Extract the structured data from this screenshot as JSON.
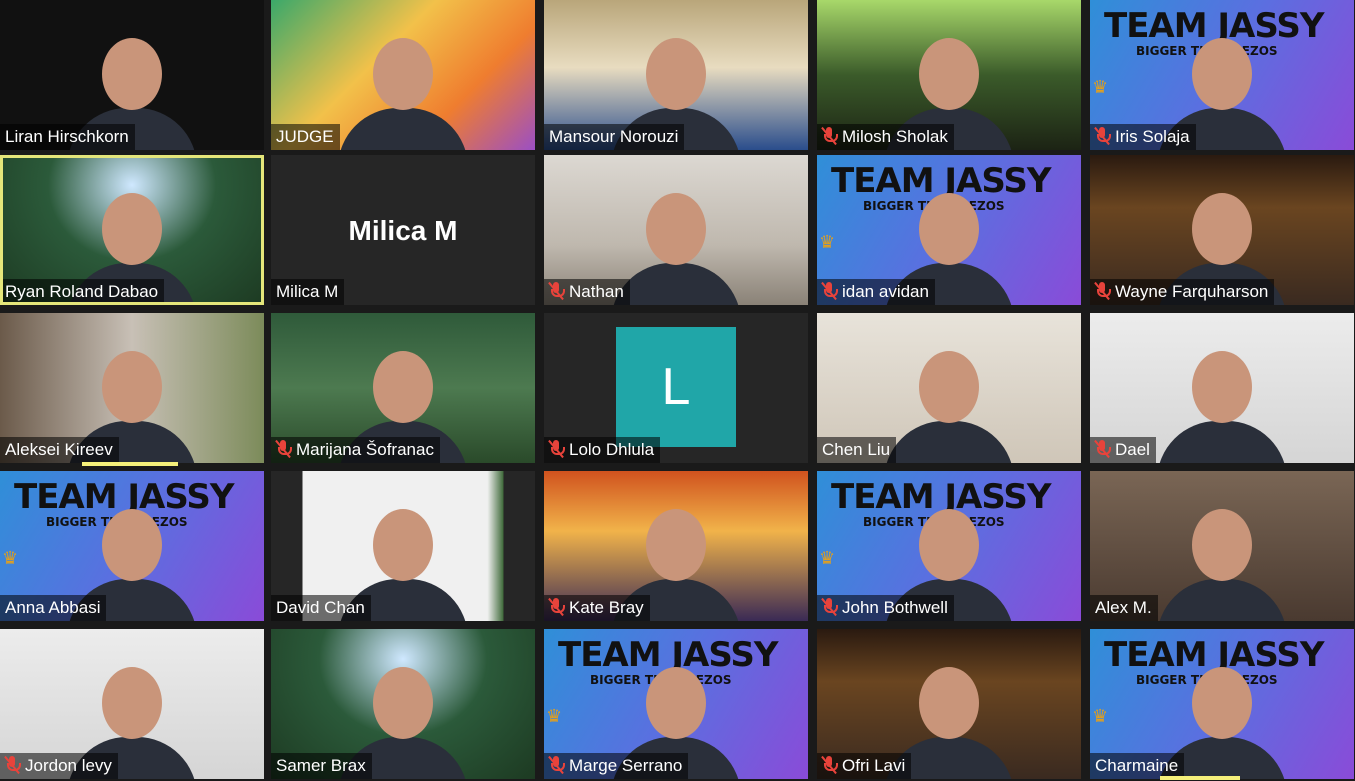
{
  "tiles": [
    {
      "name": "Liran Hirschkorn",
      "muted": false,
      "bg": "bg-dark",
      "kind": "video"
    },
    {
      "name": "JUDGE",
      "muted": false,
      "bg": "bg-olympic",
      "kind": "video"
    },
    {
      "name": "Mansour Norouzi",
      "muted": false,
      "bg": "bg-office",
      "kind": "video"
    },
    {
      "name": "Milosh Sholak",
      "muted": true,
      "bg": "bg-green",
      "kind": "video"
    },
    {
      "name": "Iris Solaja",
      "muted": true,
      "bg": "bg-jassy",
      "kind": "jassy"
    },
    {
      "name": "Ryan Roland Dabao",
      "muted": false,
      "bg": "bg-stadium",
      "kind": "video",
      "active": true
    },
    {
      "name": "Milica M",
      "muted": false,
      "bg": "bg-grey",
      "kind": "name-only",
      "center_text": "Milica M"
    },
    {
      "name": "Nathan",
      "muted": true,
      "bg": "bg-kitchen",
      "kind": "video"
    },
    {
      "name": "idan avidan",
      "muted": true,
      "bg": "bg-jassy",
      "kind": "jassy"
    },
    {
      "name": "Wayne Farquharson",
      "muted": true,
      "bg": "bg-casino",
      "kind": "video"
    },
    {
      "name": "Aleksei Kireev",
      "muted": false,
      "bg": "bg-books",
      "kind": "video"
    },
    {
      "name": "Marijana Šofranac",
      "muted": true,
      "bg": "bg-crowd",
      "kind": "video"
    },
    {
      "name": "Lolo Dhlula",
      "muted": true,
      "bg": "bg-grey",
      "kind": "avatar",
      "avatar_letter": "L"
    },
    {
      "name": "Chen Liu",
      "muted": false,
      "bg": "bg-room",
      "kind": "video"
    },
    {
      "name": "Dael",
      "muted": true,
      "bg": "bg-white",
      "kind": "video"
    },
    {
      "name": "Anna Abbasi",
      "muted": false,
      "bg": "bg-jassy",
      "kind": "jassy"
    },
    {
      "name": "David Chan",
      "muted": false,
      "bg": "bg-plant",
      "kind": "video"
    },
    {
      "name": "Kate Bray",
      "muted": true,
      "bg": "bg-fire",
      "kind": "video"
    },
    {
      "name": "John Bothwell",
      "muted": true,
      "bg": "bg-jassy",
      "kind": "jassy"
    },
    {
      "name": "Alex M.",
      "muted": false,
      "bg": "bg-brown",
      "kind": "video"
    },
    {
      "name": "Jordon levy",
      "muted": true,
      "bg": "bg-white",
      "kind": "video"
    },
    {
      "name": "Samer Brax",
      "muted": false,
      "bg": "bg-stadium",
      "kind": "video"
    },
    {
      "name": "Marge Serrano",
      "muted": true,
      "bg": "bg-jassy",
      "kind": "jassy"
    },
    {
      "name": "Ofri Lavi",
      "muted": true,
      "bg": "bg-casino",
      "kind": "video"
    },
    {
      "name": "Charmaine",
      "muted": false,
      "bg": "bg-jassy",
      "kind": "jassy"
    }
  ],
  "jassy": {
    "title": "TEAM JASSY",
    "subtitle": "BIGGER THAN BEZOS"
  },
  "icons": {
    "mute": "microphone-muted-icon"
  },
  "colors": {
    "mute_red": "#e8433b",
    "active_border": "#e5e67a",
    "avatar_teal": "#20a6a8"
  }
}
